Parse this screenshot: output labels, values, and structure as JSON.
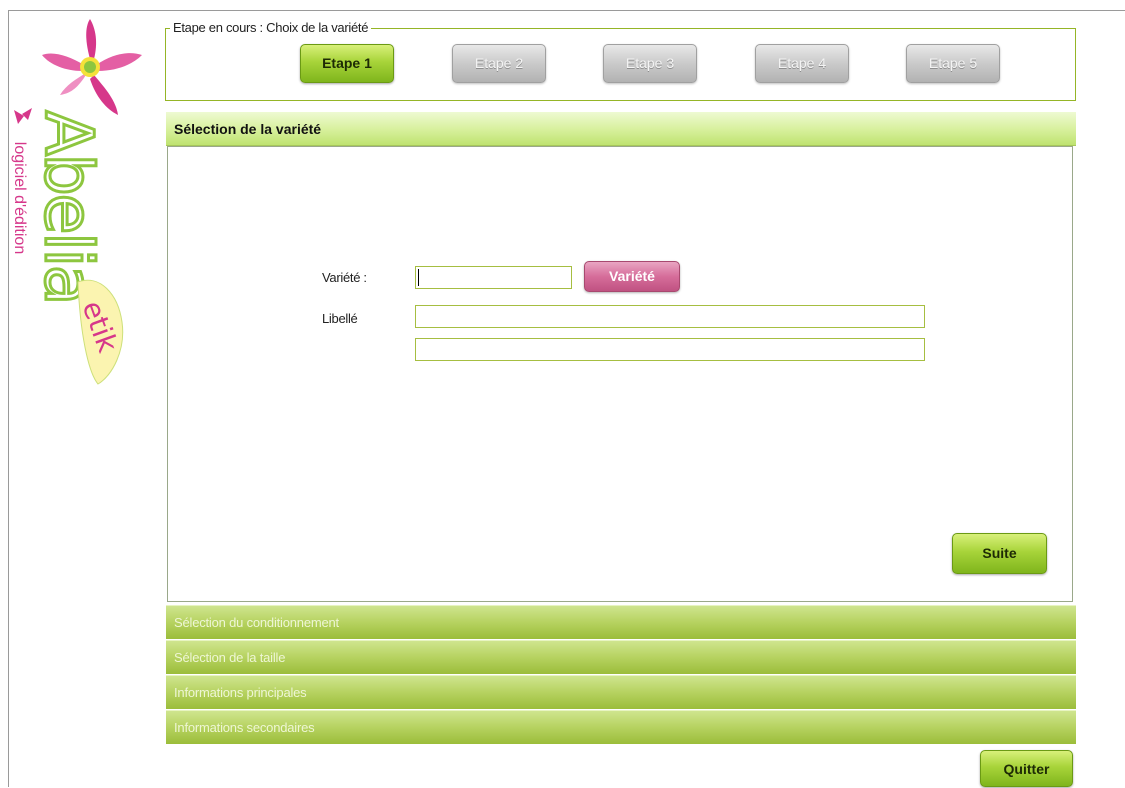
{
  "logo": {
    "brand": "Abelia",
    "sub": "etik",
    "tagline": "logiciel d'édition"
  },
  "steps": {
    "legend": "Etape en cours : Choix de la variété",
    "items": [
      {
        "label": "Etape 1",
        "state": "active"
      },
      {
        "label": "Etape 2",
        "state": "inactive"
      },
      {
        "label": "Etape 3",
        "state": "inactive"
      },
      {
        "label": "Etape 4",
        "state": "inactive"
      },
      {
        "label": "Etape 5",
        "state": "inactive"
      }
    ]
  },
  "section": {
    "title": "Sélection de la variété",
    "variety_label": "Variété :",
    "variety_value": "",
    "variety_button": "Variété",
    "libelle_label": "Libellé",
    "libelle_line1": "",
    "libelle_line2": "",
    "next_button": "Suite"
  },
  "collapsed_sections": [
    "Sélection du conditionnement",
    "Sélection de la taille",
    "Informations principales",
    "Informations secondaires"
  ],
  "footer": {
    "quit_button": "Quitter"
  },
  "colors": {
    "accent_green": "#a8d43a",
    "accent_pink": "#d66d9a",
    "logo_green": "#8dc63f",
    "logo_pink": "#d6378a"
  }
}
